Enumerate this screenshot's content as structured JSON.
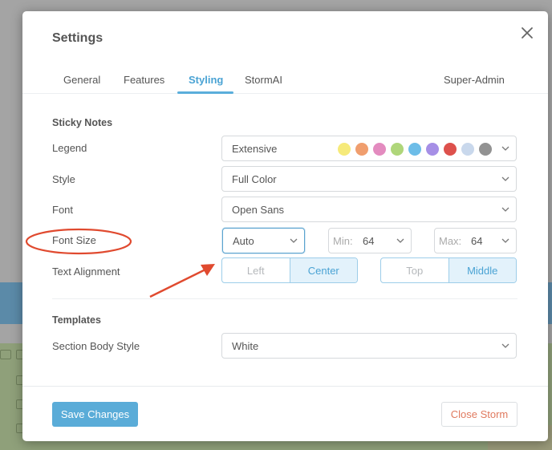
{
  "dialog": {
    "title": "Settings",
    "close_icon": "close-icon"
  },
  "tabs": [
    {
      "label": "General",
      "active": false
    },
    {
      "label": "Features",
      "active": false
    },
    {
      "label": "Styling",
      "active": true
    },
    {
      "label": "StormAI",
      "active": false
    },
    {
      "label": "Super-Admin",
      "active": false
    }
  ],
  "sticky_notes": {
    "section_title": "Sticky Notes",
    "legend": {
      "label": "Legend",
      "value": "Extensive",
      "swatches": [
        "#f6ea7a",
        "#f09e6e",
        "#e38bbf",
        "#afd67a",
        "#6dbde8",
        "#a68fe6",
        "#dd514c",
        "#c9d8ec",
        "#929292"
      ]
    },
    "style": {
      "label": "Style",
      "value": "Full Color"
    },
    "font": {
      "label": "Font",
      "value": "Open Sans"
    },
    "font_size": {
      "label": "Font Size",
      "value": "Auto",
      "min_label": "Min:",
      "min_value": "64",
      "max_label": "Max:",
      "max_value": "64"
    },
    "text_alignment": {
      "label": "Text Alignment",
      "horizontal": [
        {
          "label": "Left",
          "selected": false
        },
        {
          "label": "Center",
          "selected": true
        }
      ],
      "vertical": [
        {
          "label": "Top",
          "selected": false
        },
        {
          "label": "Middle",
          "selected": true
        }
      ]
    }
  },
  "templates": {
    "section_title": "Templates",
    "section_body_style": {
      "label": "Section Body Style",
      "value": "White"
    }
  },
  "footer": {
    "save_label": "Save Changes",
    "close_storm_label": "Close Storm"
  },
  "colors": {
    "accent": "#5aacd8",
    "danger_text": "#e07a5f",
    "annotation": "#e04a2f"
  }
}
